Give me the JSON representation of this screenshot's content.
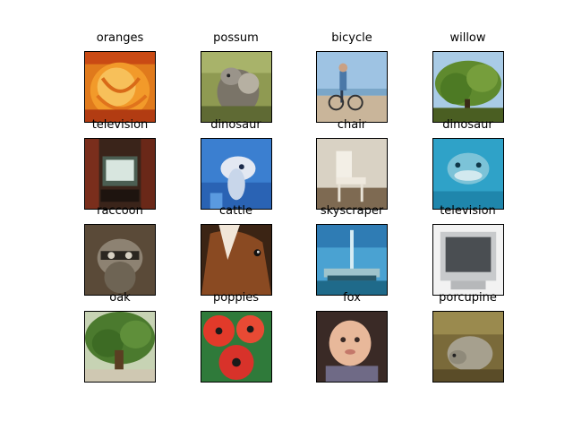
{
  "grid": {
    "images": [
      {
        "label": "oranges",
        "scene": "orange"
      },
      {
        "label": "possum",
        "scene": "possum"
      },
      {
        "label": "bicycle",
        "scene": "bicycle"
      },
      {
        "label": "willow",
        "scene": "willow"
      },
      {
        "label": "television",
        "scene": "tv-room"
      },
      {
        "label": "dinosaur",
        "scene": "blue-creature"
      },
      {
        "label": "chair",
        "scene": "chair"
      },
      {
        "label": "dinosaur",
        "scene": "dolphin"
      },
      {
        "label": "raccoon",
        "scene": "raccoon"
      },
      {
        "label": "cattle",
        "scene": "horse-head"
      },
      {
        "label": "skyscraper",
        "scene": "tower"
      },
      {
        "label": "television",
        "scene": "crt-monitor"
      },
      {
        "label": "oak",
        "scene": "oak"
      },
      {
        "label": "poppies",
        "scene": "poppies"
      },
      {
        "label": "fox",
        "scene": "child-face"
      },
      {
        "label": "porcupine",
        "scene": "porcupine"
      }
    ]
  }
}
